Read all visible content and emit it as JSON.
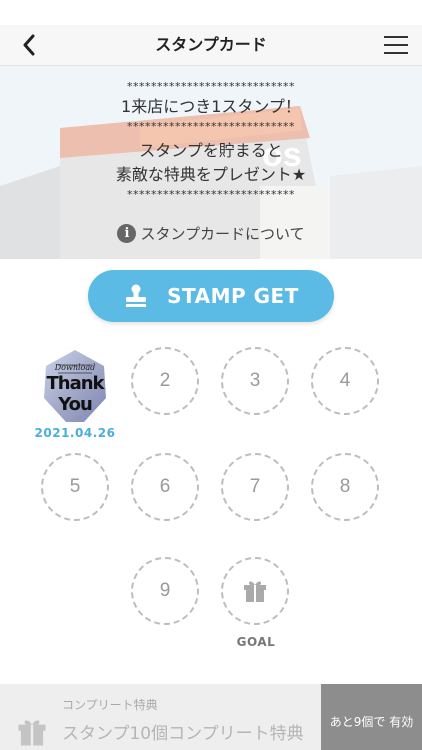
{
  "header": {
    "title": "スタンプカード"
  },
  "hero": {
    "stars": "****************************",
    "line1": "1来店につき1スタンプ！",
    "line2": "スタンプを貯まると",
    "line3": "素敵な特典をプレゼント★",
    "about_link": "スタンプカードについて"
  },
  "stamp_button": {
    "label": "STAMP GET"
  },
  "stamps": {
    "first": {
      "image_text_top": "Download",
      "image_text_1": "Thank",
      "image_text_2": "You",
      "date": "2021.04.26"
    },
    "slots": [
      "2",
      "3",
      "4",
      "5",
      "6",
      "7",
      "8",
      "9"
    ],
    "goal_label": "GOAL"
  },
  "complete": {
    "label": "コンプリート特典",
    "title": "スタンプ10個コンプリート特典",
    "badge": "あと9個で 有効"
  },
  "colors": {
    "accent": "#5cbbe4",
    "date": "#4aaedc"
  },
  "icons": [
    "back-icon",
    "menu-icon",
    "info-icon",
    "stamp-icon",
    "gift-icon"
  ]
}
